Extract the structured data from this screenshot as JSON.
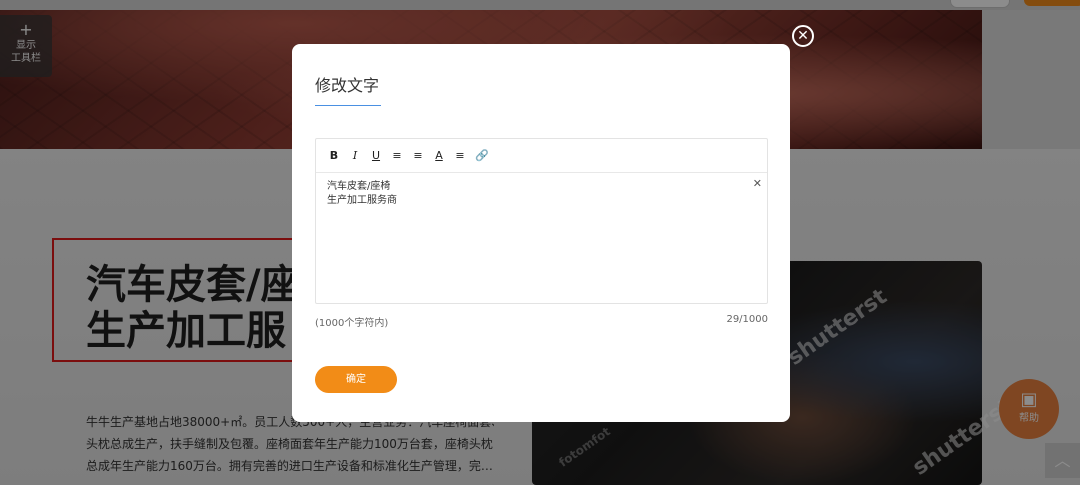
{
  "page": {
    "toolbar_tab": {
      "plus": "+",
      "line1": "显示",
      "line2": "工具栏"
    },
    "headline": {
      "line1": "汽车皮套/座",
      "line2": "生产加工服"
    },
    "paragraph": [
      "牛牛生产基地占地38000+㎡。员工人数500+人，主营业务：汽车座椅面套、",
      "头枕总成生产，扶手缝制及包覆。座椅面套年生产能力100万台套，座椅头枕",
      "总成年生产能力160万台。拥有完善的进口生产设备和标准化生产管理，完…"
    ],
    "watermarks": {
      "wm1": "shutterst",
      "wm2": "shutterst",
      "wm3": "fotomfot"
    },
    "help": {
      "label": "帮助"
    },
    "scroll_top_icon": "chevron-up-icon"
  },
  "modal": {
    "title": "修改文字",
    "toolbar": [
      {
        "label": "B",
        "name": "bold-button"
      },
      {
        "label": "I",
        "name": "italic-button"
      },
      {
        "label": "U",
        "name": "underline-button"
      },
      {
        "label": "≡",
        "name": "indent-button"
      },
      {
        "label": "≡",
        "name": "outdent-button"
      },
      {
        "label": "A",
        "name": "font-color-button"
      },
      {
        "label": "≡",
        "name": "align-button"
      },
      {
        "label": "🔗",
        "name": "link-button"
      }
    ],
    "editor_text": {
      "line1": "汽车皮套/座椅",
      "line2": "生产加工服务商"
    },
    "hint": "(1000个字符内)",
    "counter": "29/1000",
    "confirm_label": "确定",
    "close_icon": "close-icon"
  },
  "colors": {
    "accent": "#f28c17",
    "overlay": "rgba(0,0,0,0.45)",
    "highlight_frame": "#e01b1b"
  }
}
